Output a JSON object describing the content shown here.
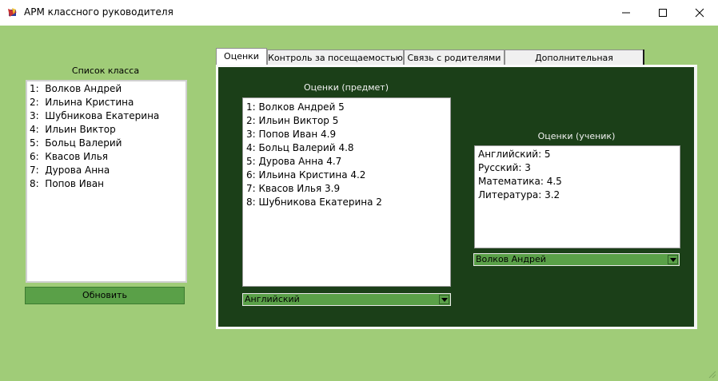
{
  "window": {
    "title": "АРМ классного руководителя",
    "colors": {
      "background": "#a0cc78",
      "panel": "#1b3f18",
      "button": "#5aa048"
    }
  },
  "class_list": {
    "label": "Список класса",
    "items": [
      "1:  Волков Андрей",
      "2:  Ильина Кристина",
      "3:  Шубникова Екатерина",
      "4:  Ильин Виктор",
      "5:  Больц Валерий",
      "6:  Квасов Илья",
      "7:  Дурова Анна",
      "8:  Попов Иван"
    ],
    "refresh_label": "Обновить"
  },
  "tabs": [
    {
      "label": "Оценки",
      "active": true
    },
    {
      "label": "Контроль за посещаемостью",
      "active": false
    },
    {
      "label": "Связь с родителями",
      "active": false
    },
    {
      "label": "Дополнительная информация",
      "active": false
    }
  ],
  "grades_subject": {
    "label": "Оценки (предмет)",
    "items": [
      "1: Волков Андрей 5",
      "2: Ильин Виктор 5",
      "3: Попов Иван 4.9",
      "4: Больц Валерий 4.8",
      "5: Дурова Анна 4.7",
      "6: Ильина Кристина 4.2",
      "7: Квасов Илья 3.9",
      "8: Шубникова Екатерина 2"
    ],
    "selected_subject": "Английский"
  },
  "grades_student": {
    "label": "Оценки (ученик)",
    "items": [
      "Английский: 5",
      "Русский: 3",
      "Математика: 4.5",
      "Литература: 3.2"
    ],
    "selected_student": "Волков Андрей"
  }
}
